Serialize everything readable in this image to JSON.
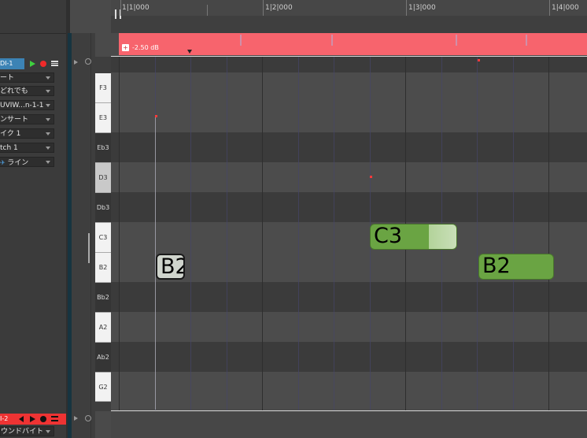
{
  "ruler": {
    "labels": [
      "1|1|000",
      "1|2|000",
      "1|3|000",
      "1|4|000"
    ]
  },
  "automation": {
    "label": "-2.50 dB",
    "plus": "+"
  },
  "track1": {
    "name": "DI-1",
    "color": "#69a644",
    "dropdowns": [
      "ート",
      "どれでも",
      "UVIW...n-1-1",
      "ンサート",
      "イク 1",
      "tch 1",
      "ライン"
    ]
  },
  "track2": {
    "name": "I-2",
    "color": "#e33333",
    "dropdown": "ウンドバイト"
  },
  "keys": [
    "F3",
    "E3",
    "Eb3",
    "D3",
    "Db3",
    "C3",
    "B2",
    "Bb2",
    "A2",
    "Ab2",
    "G2"
  ],
  "notes": [
    {
      "label": "B2"
    },
    {
      "label": "C3"
    },
    {
      "label": "B2"
    }
  ],
  "colors": {
    "note_green": "#6aa443",
    "automation": "#f7646d"
  }
}
